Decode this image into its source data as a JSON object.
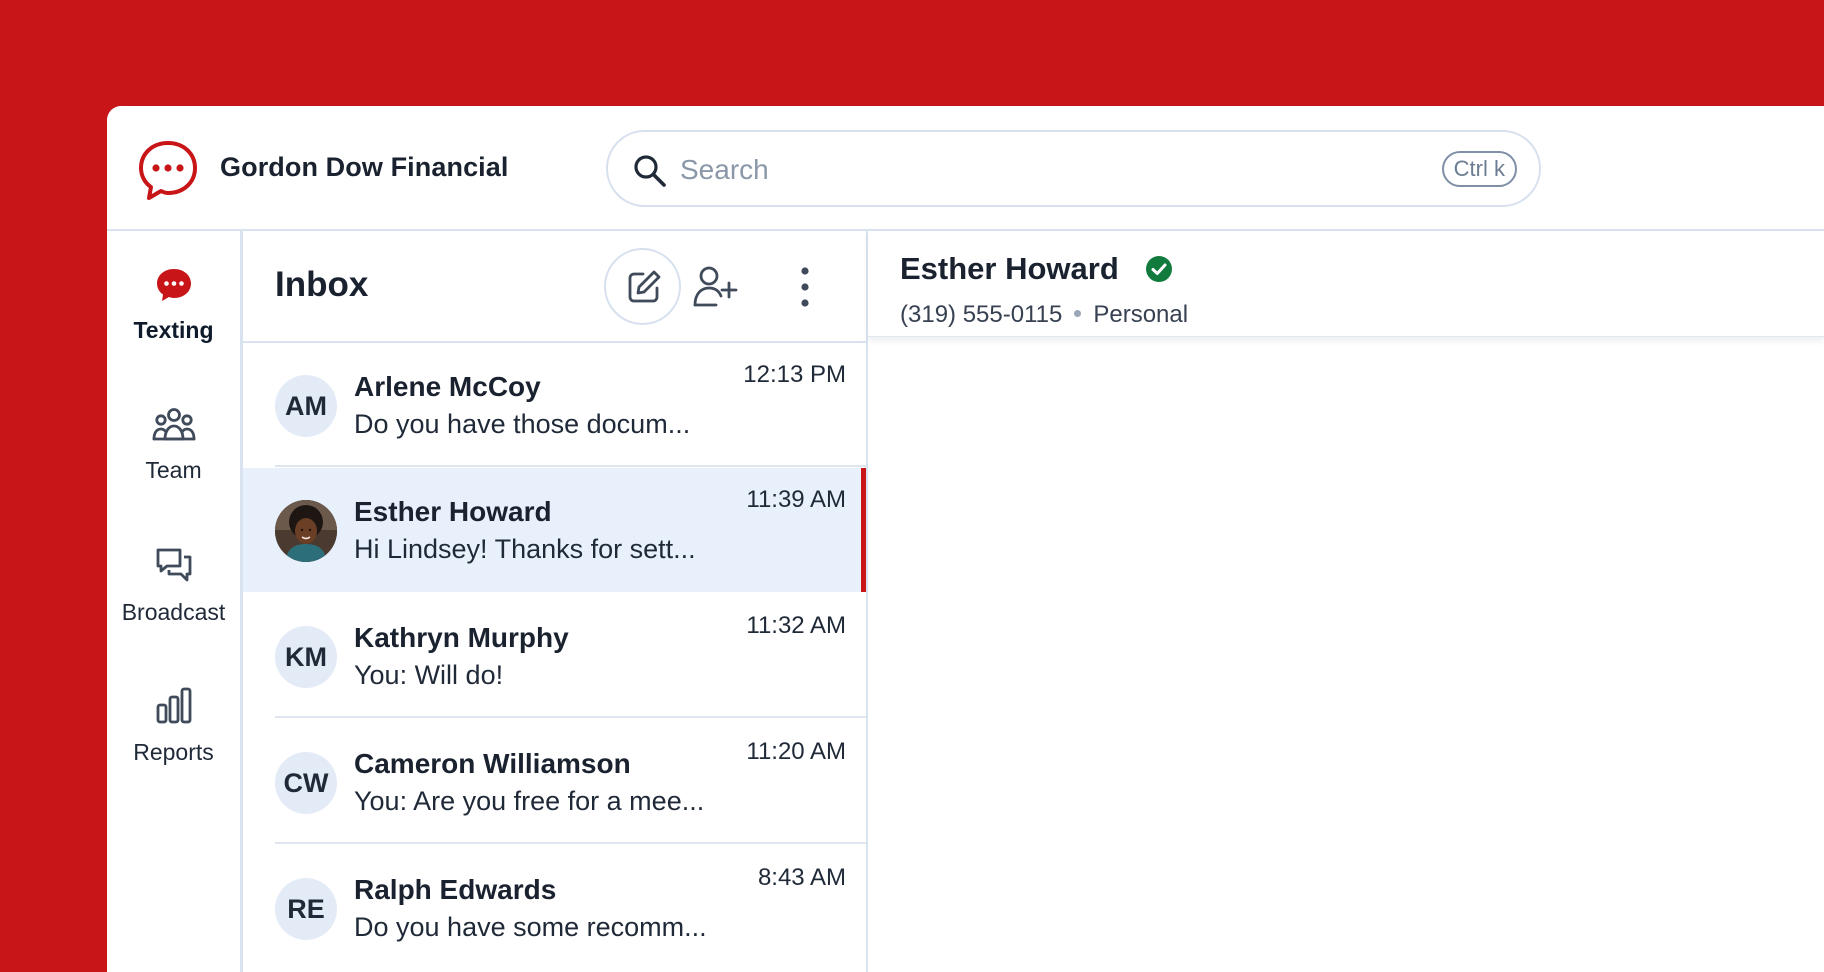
{
  "app": {
    "org_name": "Gordon Dow Financial",
    "brand_color": "#C81517",
    "logo_icon": "chat-bubble-dots-icon"
  },
  "search": {
    "placeholder": "Search",
    "value": "",
    "shortcut": "Ctrl k"
  },
  "nav": {
    "items": [
      {
        "label": "Texting",
        "icon": "chat-bubble-icon",
        "active": true
      },
      {
        "label": "Team",
        "icon": "team-icon",
        "active": false
      },
      {
        "label": "Broadcast",
        "icon": "broadcast-icon",
        "active": false
      },
      {
        "label": "Reports",
        "icon": "reports-icon",
        "active": false
      }
    ]
  },
  "inbox": {
    "title": "Inbox",
    "conversations": [
      {
        "initials": "AM",
        "name": "Arlene McCoy",
        "preview": "Do you have those docum...",
        "time": "12:13 PM",
        "selected": false
      },
      {
        "initials": "",
        "name": "Esther Howard",
        "preview": "Hi Lindsey! Thanks for sett...",
        "time": "11:39 AM",
        "selected": true,
        "avatar": "photo"
      },
      {
        "initials": "KM",
        "name": "Kathryn Murphy",
        "preview": "You: Will do!",
        "time": "11:32 AM",
        "selected": false
      },
      {
        "initials": "CW",
        "name": "Cameron Williamson",
        "preview": "You: Are you free for a mee...",
        "time": "11:20 AM",
        "selected": false
      },
      {
        "initials": "RE",
        "name": "Ralph Edwards",
        "preview": "Do you have some recomm...",
        "time": "8:43 AM",
        "selected": false
      }
    ]
  },
  "detail": {
    "contact_name": "Esther Howard",
    "verified": true,
    "phone": "(319) 555-0115",
    "phone_type": "Personal"
  }
}
